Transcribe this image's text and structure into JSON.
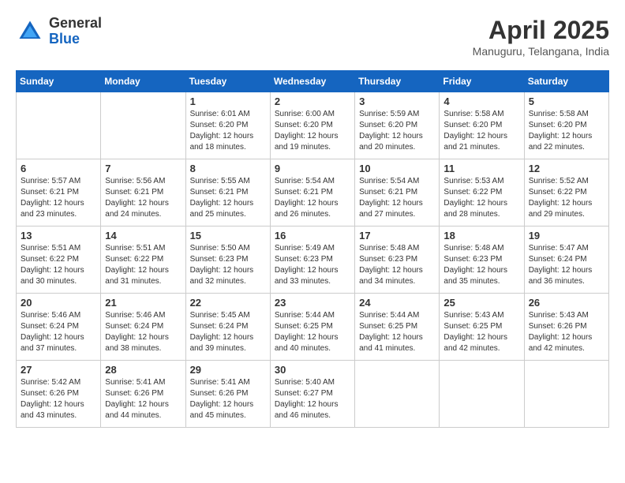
{
  "header": {
    "logo_line1": "General",
    "logo_line2": "Blue",
    "month_year": "April 2025",
    "location": "Manuguru, Telangana, India"
  },
  "weekdays": [
    "Sunday",
    "Monday",
    "Tuesday",
    "Wednesday",
    "Thursday",
    "Friday",
    "Saturday"
  ],
  "weeks": [
    [
      {
        "day": "",
        "info": ""
      },
      {
        "day": "",
        "info": ""
      },
      {
        "day": "1",
        "info": "Sunrise: 6:01 AM\nSunset: 6:20 PM\nDaylight: 12 hours\nand 18 minutes."
      },
      {
        "day": "2",
        "info": "Sunrise: 6:00 AM\nSunset: 6:20 PM\nDaylight: 12 hours\nand 19 minutes."
      },
      {
        "day": "3",
        "info": "Sunrise: 5:59 AM\nSunset: 6:20 PM\nDaylight: 12 hours\nand 20 minutes."
      },
      {
        "day": "4",
        "info": "Sunrise: 5:58 AM\nSunset: 6:20 PM\nDaylight: 12 hours\nand 21 minutes."
      },
      {
        "day": "5",
        "info": "Sunrise: 5:58 AM\nSunset: 6:20 PM\nDaylight: 12 hours\nand 22 minutes."
      }
    ],
    [
      {
        "day": "6",
        "info": "Sunrise: 5:57 AM\nSunset: 6:21 PM\nDaylight: 12 hours\nand 23 minutes."
      },
      {
        "day": "7",
        "info": "Sunrise: 5:56 AM\nSunset: 6:21 PM\nDaylight: 12 hours\nand 24 minutes."
      },
      {
        "day": "8",
        "info": "Sunrise: 5:55 AM\nSunset: 6:21 PM\nDaylight: 12 hours\nand 25 minutes."
      },
      {
        "day": "9",
        "info": "Sunrise: 5:54 AM\nSunset: 6:21 PM\nDaylight: 12 hours\nand 26 minutes."
      },
      {
        "day": "10",
        "info": "Sunrise: 5:54 AM\nSunset: 6:21 PM\nDaylight: 12 hours\nand 27 minutes."
      },
      {
        "day": "11",
        "info": "Sunrise: 5:53 AM\nSunset: 6:22 PM\nDaylight: 12 hours\nand 28 minutes."
      },
      {
        "day": "12",
        "info": "Sunrise: 5:52 AM\nSunset: 6:22 PM\nDaylight: 12 hours\nand 29 minutes."
      }
    ],
    [
      {
        "day": "13",
        "info": "Sunrise: 5:51 AM\nSunset: 6:22 PM\nDaylight: 12 hours\nand 30 minutes."
      },
      {
        "day": "14",
        "info": "Sunrise: 5:51 AM\nSunset: 6:22 PM\nDaylight: 12 hours\nand 31 minutes."
      },
      {
        "day": "15",
        "info": "Sunrise: 5:50 AM\nSunset: 6:23 PM\nDaylight: 12 hours\nand 32 minutes."
      },
      {
        "day": "16",
        "info": "Sunrise: 5:49 AM\nSunset: 6:23 PM\nDaylight: 12 hours\nand 33 minutes."
      },
      {
        "day": "17",
        "info": "Sunrise: 5:48 AM\nSunset: 6:23 PM\nDaylight: 12 hours\nand 34 minutes."
      },
      {
        "day": "18",
        "info": "Sunrise: 5:48 AM\nSunset: 6:23 PM\nDaylight: 12 hours\nand 35 minutes."
      },
      {
        "day": "19",
        "info": "Sunrise: 5:47 AM\nSunset: 6:24 PM\nDaylight: 12 hours\nand 36 minutes."
      }
    ],
    [
      {
        "day": "20",
        "info": "Sunrise: 5:46 AM\nSunset: 6:24 PM\nDaylight: 12 hours\nand 37 minutes."
      },
      {
        "day": "21",
        "info": "Sunrise: 5:46 AM\nSunset: 6:24 PM\nDaylight: 12 hours\nand 38 minutes."
      },
      {
        "day": "22",
        "info": "Sunrise: 5:45 AM\nSunset: 6:24 PM\nDaylight: 12 hours\nand 39 minutes."
      },
      {
        "day": "23",
        "info": "Sunrise: 5:44 AM\nSunset: 6:25 PM\nDaylight: 12 hours\nand 40 minutes."
      },
      {
        "day": "24",
        "info": "Sunrise: 5:44 AM\nSunset: 6:25 PM\nDaylight: 12 hours\nand 41 minutes."
      },
      {
        "day": "25",
        "info": "Sunrise: 5:43 AM\nSunset: 6:25 PM\nDaylight: 12 hours\nand 42 minutes."
      },
      {
        "day": "26",
        "info": "Sunrise: 5:43 AM\nSunset: 6:26 PM\nDaylight: 12 hours\nand 42 minutes."
      }
    ],
    [
      {
        "day": "27",
        "info": "Sunrise: 5:42 AM\nSunset: 6:26 PM\nDaylight: 12 hours\nand 43 minutes."
      },
      {
        "day": "28",
        "info": "Sunrise: 5:41 AM\nSunset: 6:26 PM\nDaylight: 12 hours\nand 44 minutes."
      },
      {
        "day": "29",
        "info": "Sunrise: 5:41 AM\nSunset: 6:26 PM\nDaylight: 12 hours\nand 45 minutes."
      },
      {
        "day": "30",
        "info": "Sunrise: 5:40 AM\nSunset: 6:27 PM\nDaylight: 12 hours\nand 46 minutes."
      },
      {
        "day": "",
        "info": ""
      },
      {
        "day": "",
        "info": ""
      },
      {
        "day": "",
        "info": ""
      }
    ]
  ]
}
